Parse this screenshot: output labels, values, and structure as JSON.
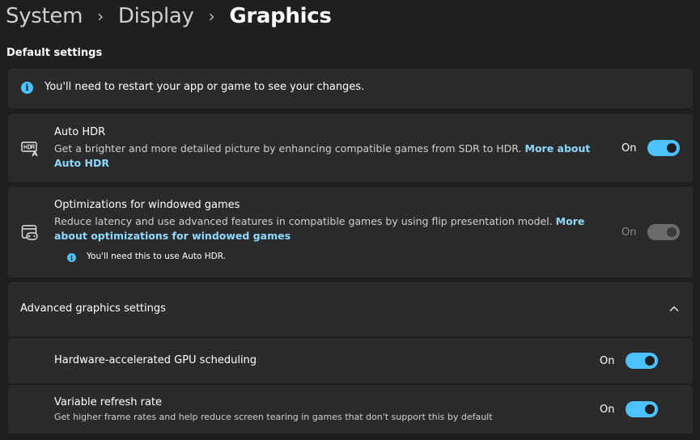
{
  "breadcrumb": {
    "items": [
      "System",
      "Display"
    ],
    "current": "Graphics",
    "separator": "›"
  },
  "section_title": "Default settings",
  "restart_notice": "You'll need to restart your app or game to see your changes.",
  "auto_hdr": {
    "title": "Auto HDR",
    "description": "Get a brighter and more detailed picture by enhancing compatible games from SDR to HDR.",
    "link": "More about Auto HDR",
    "state": "On",
    "enabled": true
  },
  "windowed": {
    "title": "Optimizations for windowed games",
    "description": "Reduce latency and use advanced features in compatible games by using flip presentation model.",
    "link": "More about optimizations for windowed games",
    "note": "You'll need this to use Auto HDR.",
    "state": "On",
    "enabled": false
  },
  "advanced": {
    "title": "Advanced graphics settings",
    "items": [
      {
        "title": "Hardware-accelerated GPU scheduling",
        "description": "",
        "state": "On"
      },
      {
        "title": "Variable refresh rate",
        "description": "Get higher frame rates and help reduce screen tearing in games that don't support this by default",
        "state": "On"
      }
    ]
  },
  "colors": {
    "accent": "#4cc2ff",
    "background": "#1f1f1f",
    "card": "#2b2b2b",
    "link": "#8fd8ff"
  }
}
